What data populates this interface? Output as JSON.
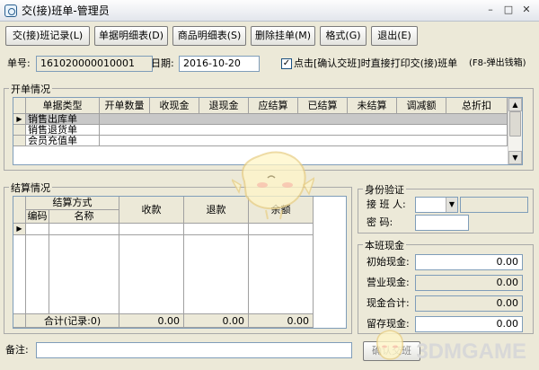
{
  "window": {
    "title": "交(接)班单-管理员",
    "minimize": "–",
    "maximize": "□",
    "close": "✕"
  },
  "toolbar": {
    "buttons": [
      "交(接)班记录(L)",
      "单据明细表(D)",
      "商品明细表(S)",
      "删除挂单(M)",
      "格式(G)",
      "退出(E)"
    ]
  },
  "header": {
    "doc_no_label": "单号:",
    "doc_no_value": "161020000010001",
    "date_label": "日期:",
    "date_value": "2016-10-20",
    "print_checkbox_label": "点击[确认交班]时直接打印交(接)班单",
    "print_checked": true,
    "hint": "(F8-弹出钱箱)"
  },
  "open_section": {
    "title": "开单情况",
    "columns": [
      "单据类型",
      "开单数量",
      "收现金",
      "退现金",
      "应结算",
      "已结算",
      "未结算",
      "调减额",
      "总折扣"
    ],
    "rows": [
      "销售出库单",
      "销售退货单",
      "会员充值单"
    ]
  },
  "settle_section": {
    "title": "结算情况",
    "method_header": "结算方式",
    "code_header": "编码",
    "name_header": "名称",
    "receive_header": "收款",
    "refund_header": "退款",
    "balance_header": "余额",
    "total_label": "合计(记录:0)",
    "total_receive": "0.00",
    "total_refund": "0.00",
    "total_balance": "0.00"
  },
  "identity_section": {
    "title": "身份验证",
    "receiver_label": "接 班 人:",
    "password_label": "密    码:"
  },
  "cash_section": {
    "title": "本班现金",
    "initial_label": "初始现金:",
    "initial_value": "0.00",
    "business_label": "营业现金:",
    "business_value": "0.00",
    "total_label": "现金合计:",
    "total_value": "0.00",
    "retain_label": "留存现金:",
    "retain_value": "0.00"
  },
  "footer": {
    "remark_label": "备注:",
    "confirm_button": "确认交班",
    "watermark": "3DMGAME"
  }
}
